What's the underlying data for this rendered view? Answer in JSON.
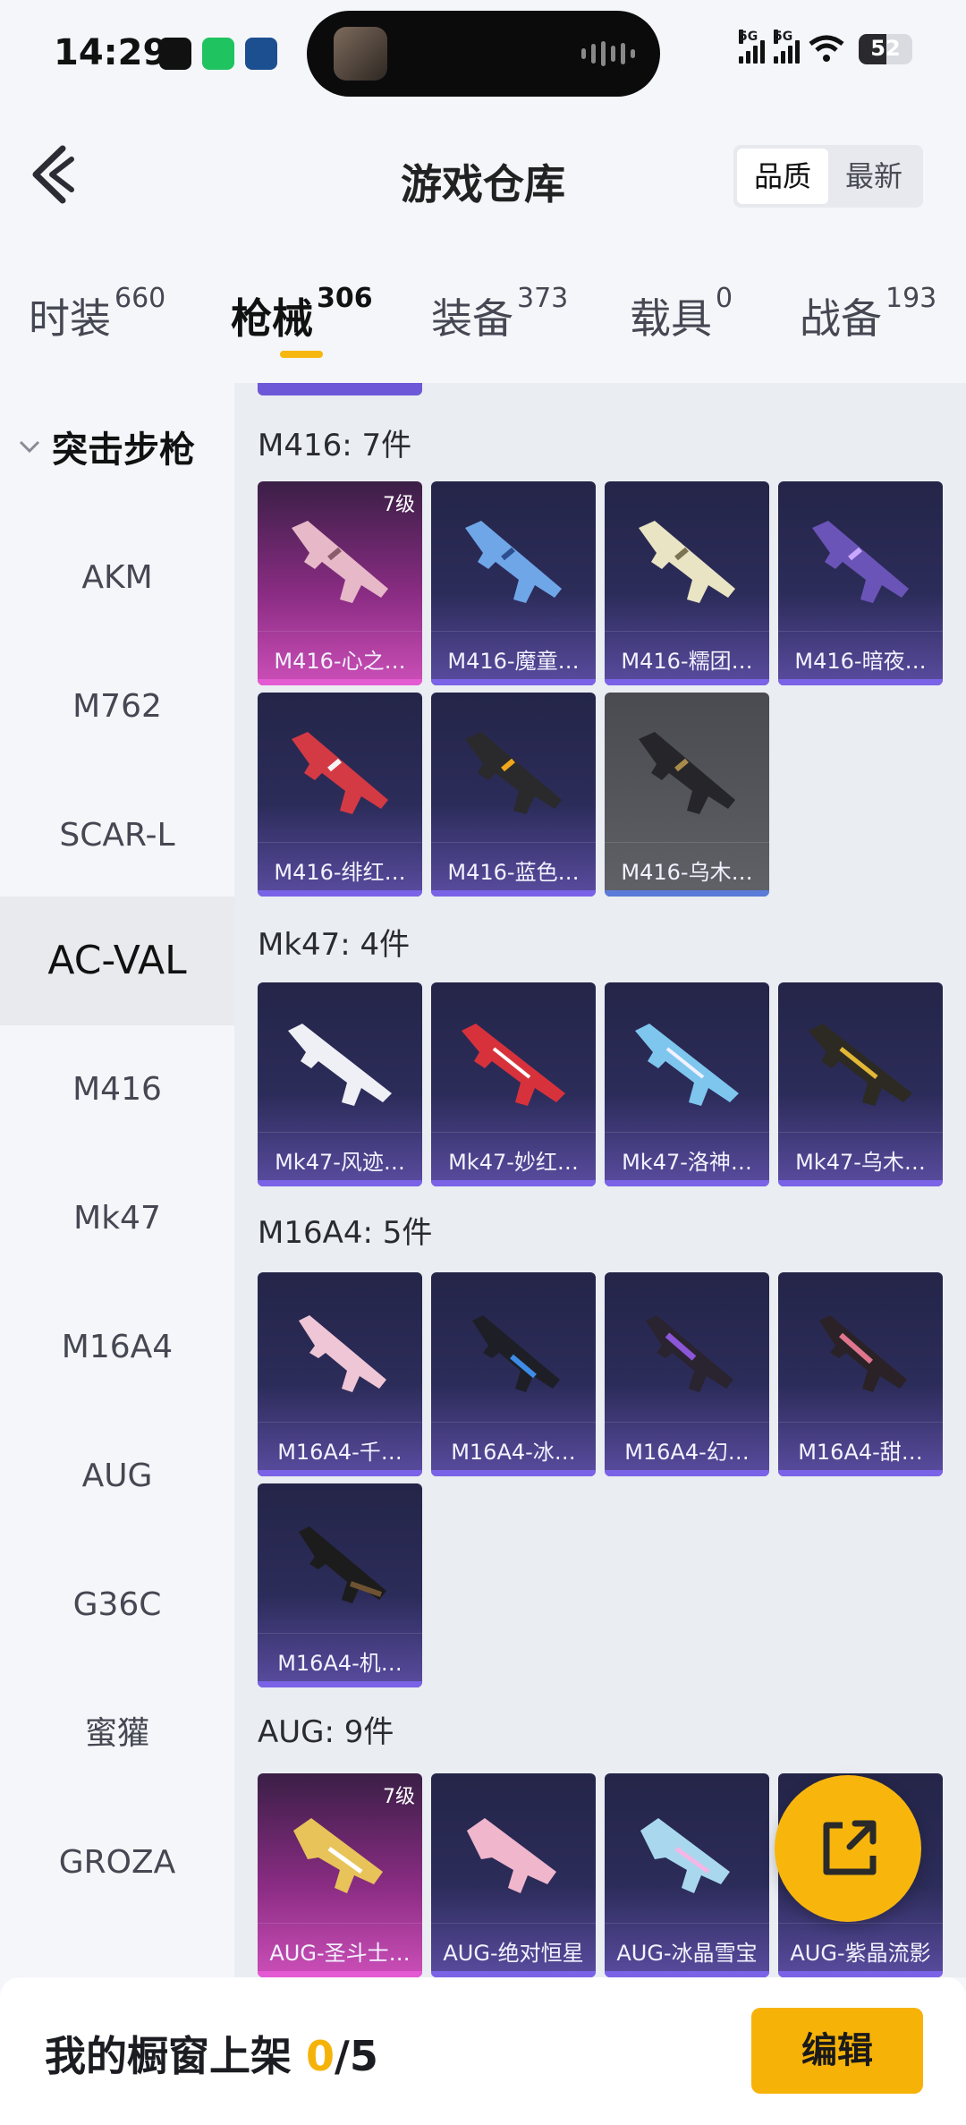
{
  "status": {
    "time": "14:29",
    "network_1": "5G",
    "network_2": "5G",
    "battery": "52"
  },
  "header": {
    "title": "游戏仓库",
    "sort_options": [
      "品质",
      "最新"
    ],
    "sort_active": "品质"
  },
  "tabs": [
    {
      "label": "时装",
      "count": "660"
    },
    {
      "label": "枪械",
      "count": "306"
    },
    {
      "label": "装备",
      "count": "373"
    },
    {
      "label": "载具",
      "count": "0"
    },
    {
      "label": "战备",
      "count": "193"
    }
  ],
  "sidebar": {
    "group": "突击步枪",
    "items": [
      "AKM",
      "M762",
      "SCAR-L",
      "AC-VAL",
      "M416",
      "Mk47",
      "M16A4",
      "AUG",
      "G36C",
      "蜜獾",
      "GROZA"
    ],
    "active": "AC-VAL"
  },
  "sections": [
    {
      "title": "M416: 7件",
      "items": [
        {
          "label": "M416-心之…",
          "level": "7级",
          "tier": "gold"
        },
        {
          "label": "M416-魔童…",
          "tier": "purple"
        },
        {
          "label": "M416-糯团…",
          "tier": "purple"
        },
        {
          "label": "M416-暗夜…",
          "tier": "purple"
        },
        {
          "label": "M416-绯红…",
          "tier": "purple"
        },
        {
          "label": "M416-蓝色…",
          "tier": "purple"
        },
        {
          "label": "M416-乌木…",
          "tier": "grey"
        }
      ]
    },
    {
      "title": "Mk47: 4件",
      "items": [
        {
          "label": "Mk47-风迹…",
          "tier": "purple"
        },
        {
          "label": "Mk47-妙红…",
          "tier": "purple"
        },
        {
          "label": "Mk47-洛神…",
          "tier": "purple"
        },
        {
          "label": "Mk47-乌木…",
          "tier": "purple"
        }
      ]
    },
    {
      "title": "M16A4: 5件",
      "items": [
        {
          "label": "M16A4-千…",
          "tier": "purple"
        },
        {
          "label": "M16A4-冰…",
          "tier": "purple"
        },
        {
          "label": "M16A4-幻…",
          "tier": "purple"
        },
        {
          "label": "M16A4-甜…",
          "tier": "purple"
        },
        {
          "label": "M16A4-机…",
          "tier": "purple"
        }
      ]
    },
    {
      "title": "AUG: 9件",
      "items": [
        {
          "label": "AUG-圣斗士…",
          "level": "7级",
          "tier": "gold"
        },
        {
          "label": "AUG-绝对恒星",
          "tier": "purple"
        },
        {
          "label": "AUG-冰晶雪宝",
          "tier": "purple"
        },
        {
          "label": "AUG-紫晶流影",
          "tier": "purple"
        }
      ]
    }
  ],
  "bottom": {
    "showcase_label": "我的橱窗上架",
    "showcase_current": "0",
    "showcase_total": "/5",
    "edit_label": "编辑"
  },
  "icons": [
    "back-arrow-icon",
    "chevron-down-icon",
    "share-export-icon",
    "wifi-icon",
    "battery-icon"
  ],
  "colors": {
    "accent": "#f7b208",
    "card_purple": "#7a63e6",
    "card_gold": "#e35ad2"
  }
}
